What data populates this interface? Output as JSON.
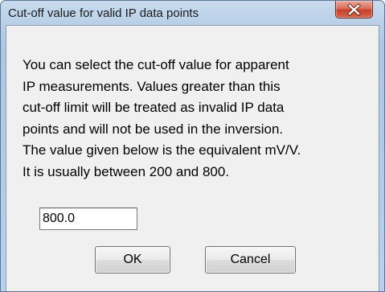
{
  "window": {
    "title": "Cut-off value for valid IP data points",
    "close_icon": "close-x-icon"
  },
  "message": {
    "lines": [
      "You can select the cut-off value for apparent",
      "IP measurements. Values greater than this",
      "cut-off limit will be treated as invalid IP data",
      "points and will not be used in the inversion.",
      "The value given below is the equivalent mV/V.",
      "It is usually between 200 and 800."
    ]
  },
  "input": {
    "value": "800.0"
  },
  "buttons": {
    "ok": "OK",
    "cancel": "Cancel"
  },
  "colors": {
    "close_button": "#c7412a",
    "dialog_background": "#f0f0f0",
    "frame": "#b9d1ea"
  }
}
